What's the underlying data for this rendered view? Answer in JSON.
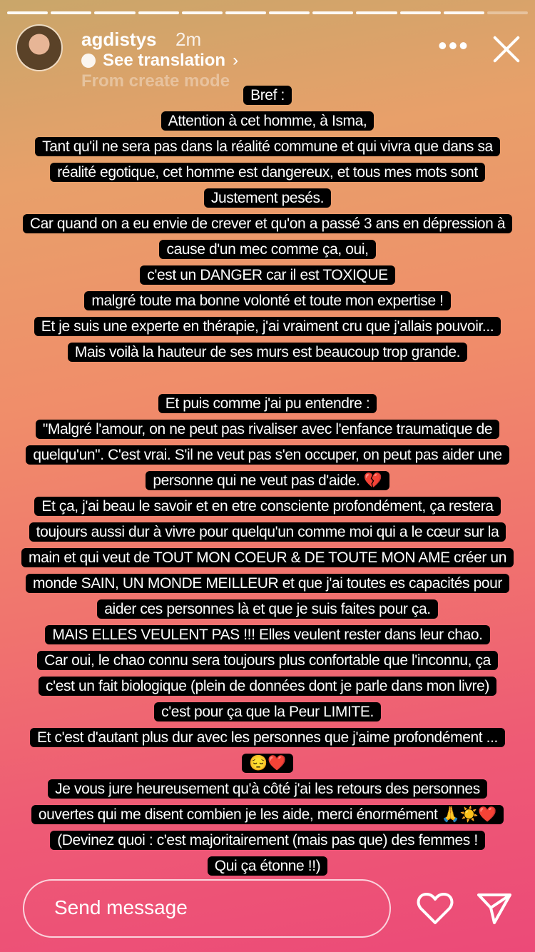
{
  "story": {
    "progress_total": 12,
    "progress_done": 11
  },
  "header": {
    "username": "agdistys",
    "time": "2m",
    "translate_label": "See translation",
    "create_mode": "From create mode"
  },
  "text_lines": [
    "Bref :",
    "Attention à cet homme, à Isma,",
    "Tant qu'il ne sera pas dans la réalité commune et qui vivra que dans sa",
    "réalité egotique, cet homme est dangereux, et tous mes mots sont",
    "Justement pesés.",
    "Car quand on a eu envie de crever et qu'on a passé 3 ans en dépression à",
    "cause d'un mec comme ça, oui,",
    "c'est un DANGER car il est TOXIQUE",
    "malgré toute ma bonne volonté et toute mon expertise !",
    "Et je suis une experte en thérapie, j'ai vraiment cru que j'allais pouvoir...",
    "Mais voilà la hauteur de ses murs est beaucoup trop grande.",
    "",
    "Et puis comme j'ai pu entendre :",
    "\"Malgré l'amour, on ne peut pas rivaliser avec l'enfance traumatique de",
    "quelqu'un\". C'est vrai. S'il ne veut pas s'en occuper, on peut pas aider une",
    "personne qui ne veut pas d'aide. 💔",
    "Et ça, j'ai beau le savoir et en etre consciente profondément, ça restera",
    "toujours aussi dur à vivre pour quelqu'un comme moi qui a le cœur sur la",
    "main et qui veut de TOUT MON COEUR  & DE TOUTE MON AME créer un",
    "monde SAIN, UN MONDE MEILLEUR et que j'ai toutes es capacités pour",
    "aider ces personnes là et que je suis faites pour ça.",
    "MAIS ELLES VEULENT PAS !!! Elles veulent rester dans leur chao.",
    "Car oui, le chao connu sera toujours plus confortable que l'inconnu, ça",
    "c'est un fait biologique (plein de données dont je parle dans mon livre)",
    "c'est pour ça que la Peur LIMITE.",
    "Et c'est d'autant plus dur avec les personnes que j'aime profondément ...",
    "😔❤️",
    "Je vous jure heureusement qu'à côté j'ai les retours des personnes",
    "ouvertes qui me disent combien je les aide, merci énormément 🙏☀️❤️",
    "(Devinez quoi : c'est majoritairement (mais pas que) des femmes !",
    "Qui ça étonne !!)"
  ],
  "footer": {
    "message_placeholder": "Send message"
  },
  "icons": {
    "avatar": "profile-avatar",
    "more": "more-icon",
    "close": "close-icon",
    "like": "heart-icon",
    "send": "send-icon"
  }
}
